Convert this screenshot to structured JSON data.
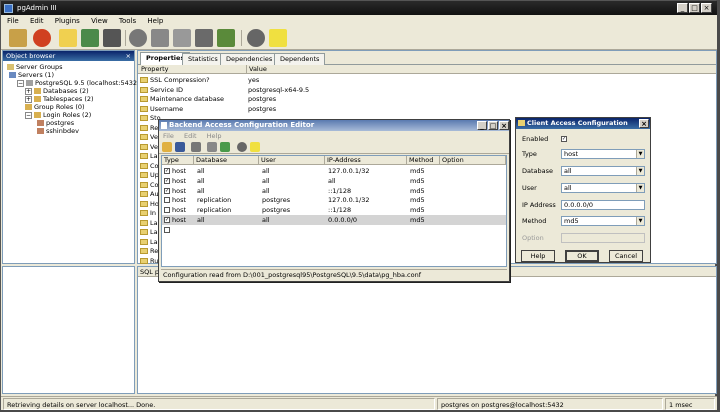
{
  "window": {
    "title": "pgAdmin III"
  },
  "menu": [
    "File",
    "Edit",
    "Plugins",
    "View",
    "Tools",
    "Help"
  ],
  "object_browser": {
    "title": "Object browser",
    "tree": [
      {
        "label": "Server Groups",
        "level": 0
      },
      {
        "label": "Servers (1)",
        "level": 1
      },
      {
        "label": "PostgreSQL 9.5 (localhost:5432)",
        "level": 2
      },
      {
        "label": "Databases (2)",
        "level": 3
      },
      {
        "label": "Tablespaces (2)",
        "level": 3
      },
      {
        "label": "Group Roles (0)",
        "level": 3
      },
      {
        "label": "Login Roles (2)",
        "level": 3
      },
      {
        "label": "postgres",
        "level": 4
      },
      {
        "label": "sshinbdev",
        "level": 4
      }
    ]
  },
  "properties": {
    "tabs": [
      "Properties",
      "Statistics",
      "Dependencies",
      "Dependents"
    ],
    "col_property": "Property",
    "col_value": "Value",
    "rows": [
      {
        "p": "SSL Compression?",
        "v": "yes"
      },
      {
        "p": "Service ID",
        "v": "postgresql-x64-9.5"
      },
      {
        "p": "Maintenance database",
        "v": "postgres"
      },
      {
        "p": "Username",
        "v": "postgres"
      },
      {
        "p": "Sto",
        "v": ""
      },
      {
        "p": "Re",
        "v": ""
      },
      {
        "p": "Ve",
        "v": ""
      },
      {
        "p": "Ve",
        "v": ""
      },
      {
        "p": "Las",
        "v": ""
      },
      {
        "p": "Co",
        "v": ""
      },
      {
        "p": "Up",
        "v": ""
      },
      {
        "p": "Co",
        "v": ""
      },
      {
        "p": "Au",
        "v": ""
      },
      {
        "p": "Ho",
        "v": ""
      },
      {
        "p": "In",
        "v": ""
      },
      {
        "p": "Las",
        "v": ""
      },
      {
        "p": "Las",
        "v": ""
      },
      {
        "p": "Las",
        "v": ""
      },
      {
        "p": "Re",
        "v": ""
      },
      {
        "p": "Ru",
        "v": ""
      }
    ]
  },
  "sql_pane": {
    "label": "SQL pan"
  },
  "hba": {
    "title": "Backend Access Configuration Editor",
    "menu": [
      "File",
      "Edit",
      "Help"
    ],
    "columns": [
      "Type",
      "Database",
      "User",
      "IP-Address",
      "Method",
      "Option"
    ],
    "rows": [
      {
        "checked": true,
        "type": "host",
        "db": "all",
        "user": "all",
        "ip": "127.0.0.1/32",
        "method": "md5",
        "sel": false
      },
      {
        "checked": true,
        "type": "host",
        "db": "all",
        "user": "all",
        "ip": "all",
        "method": "md5",
        "sel": false
      },
      {
        "checked": true,
        "type": "host",
        "db": "all",
        "user": "all",
        "ip": "::1/128",
        "method": "md5",
        "sel": false
      },
      {
        "checked": false,
        "type": "host",
        "db": "replication",
        "user": "postgres",
        "ip": "127.0.0.1/32",
        "method": "md5",
        "sel": false
      },
      {
        "checked": false,
        "type": "host",
        "db": "replication",
        "user": "postgres",
        "ip": "::1/128",
        "method": "md5",
        "sel": false
      },
      {
        "checked": true,
        "type": "host",
        "db": "all",
        "user": "all",
        "ip": "0.0.0.0/0",
        "method": "md5",
        "sel": true
      },
      {
        "checked": false,
        "type": "",
        "db": "",
        "user": "",
        "ip": "",
        "method": "",
        "sel": false
      }
    ],
    "status": "Configuration read from D:\\001_postgresql95\\PostgreSQL\\9.5\\data\\pg_hba.conf"
  },
  "client_access": {
    "title": "Client Access Configuration",
    "enabled_label": "Enabled",
    "type_label": "Type",
    "type_value": "host",
    "database_label": "Database",
    "database_value": "all",
    "user_label": "User",
    "user_value": "all",
    "ip_label": "IP Address",
    "ip_value": "0.0.0.0/0",
    "method_label": "Method",
    "method_value": "md5",
    "option_label": "Option",
    "help": "Help",
    "ok": "OK",
    "cancel": "Cancel"
  },
  "status": {
    "message": "Retrieving details on server localhost... Done.",
    "connection": "postgres on postgres@localhost:5432",
    "time": "1 msec"
  }
}
